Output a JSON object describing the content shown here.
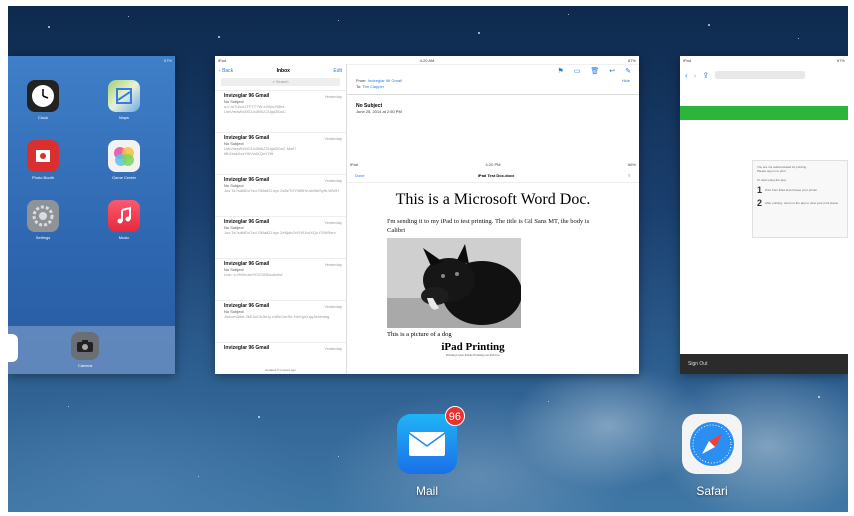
{
  "home": {
    "status_battery": "67%",
    "apps": [
      {
        "label": "Clock",
        "icon": "clock-icon"
      },
      {
        "label": "Maps",
        "icon": "maps-icon"
      },
      {
        "label": "Photo Booth",
        "icon": "photo-booth-icon"
      },
      {
        "label": "Game Center",
        "icon": "game-center-icon"
      },
      {
        "label": "Settings",
        "icon": "gear-icon"
      },
      {
        "label": "Music",
        "icon": "music-note-icon"
      }
    ],
    "dock_apps": [
      {
        "label": "Camera",
        "icon": "camera-icon"
      }
    ]
  },
  "mail": {
    "status_left": "iPad",
    "status_time": "4:20 AM",
    "status_battery": "67%",
    "back_label": "Back",
    "list_title": "Inbox",
    "edit_label": "Edit",
    "search_placeholder": "Search",
    "messages": [
      {
        "sender": "Invizeglar 96 Gmail",
        "date": "Yesterday",
        "subject": "No Subject",
        "preview": "s://-m?UvoUTFYT7W-e2Wa-R6bz UmVmaWx5IG1lc3NhZ2Ugd2l0aC"
      },
      {
        "sender": "Invizeglar 96 Gmail",
        "date": "Yesterday",
        "subject": "No Subject",
        "preview": "UmVmaWx5IG1lc3NhZ2Ugd2l0aC Mail?Mb2xsb2xsYWJvdXQuY29t"
      },
      {
        "sender": "Invizeglar 96 Gmail",
        "date": "Yesterday",
        "subject": "No Subject",
        "preview": "Jus Ta?sdkfDo7sd-SMaitZLhys 2s8eTGYMBHz-slrt6eSyfb-WWH"
      },
      {
        "sender": "Invizeglar 96 Gmail",
        "date": "Yesterday",
        "subject": "No Subject",
        "preview": "Jus Ta?sdkfDo7sd-SMaitZLhys 2eNjsb2xlYWJvdXQuY29tlServ"
      },
      {
        "sender": "Invizeglar 96 Gmail",
        "date": "Yesterday",
        "subject": "No Subject",
        "preview": "Link: s://hWxJwYlOG3l3Ncotxdvt"
      },
      {
        "sender": "Invizeglar 96 Gmail",
        "date": "Yesterday",
        "subject": "No Subject",
        "preview": "Jsncen3dsf-2kE4uC6JbUy mEkCdeSe-HeVgnXqqJmtlmmg"
      },
      {
        "sender": "Invizeglar 96 Gmail",
        "date": "Yesterday",
        "subject": "No Subject",
        "preview": ""
      }
    ],
    "footer_text": "Updated 5 minutes ago",
    "detail": {
      "from_label": "From:",
      "from_value": "Invizeglar 96 Gmail",
      "hide_label": "Hide",
      "to_label": "To:",
      "to_value": "Tim Clapper",
      "subject": "No Subject",
      "date": "June 25, 2014 at 2:50 PM",
      "attachment": {
        "status_left": "iPad",
        "status_time": "4:20 PM",
        "status_battery": "66%",
        "done_label": "Done",
        "doc_name": "iPad Test Doc.docx",
        "doc_heading": "This is a Microsoft Word Doc.",
        "doc_para": "I'm sending it to my iPad to test printing. The title is Gil Sans MT, the body is Calibri",
        "doc_caption": "This is a picture of a dog",
        "doc_h2": "iPad Printing",
        "doc_small": "Printing Listen Padded Printing test Padd Go"
      }
    }
  },
  "safari": {
    "status_left": "iPad",
    "status_battery": "67%",
    "panel_line1": "You are not authenticated for printing.",
    "panel_line2": "Please sign in to print",
    "panel_title": "To start using the app:",
    "step1_num": "1",
    "step1_text": "Print from iPad and choose your printer",
    "step2_num": "2",
    "step2_text": "After printing, return to the app to view your print status",
    "footer": "Sign Out"
  },
  "dock_bottom": {
    "mail_label": "Mail",
    "mail_badge": "96",
    "safari_label": "Safari"
  },
  "colors": {
    "ios_blue": "#2b7ae3",
    "badge_red": "#e8322f",
    "safari_green": "#2db43a"
  }
}
